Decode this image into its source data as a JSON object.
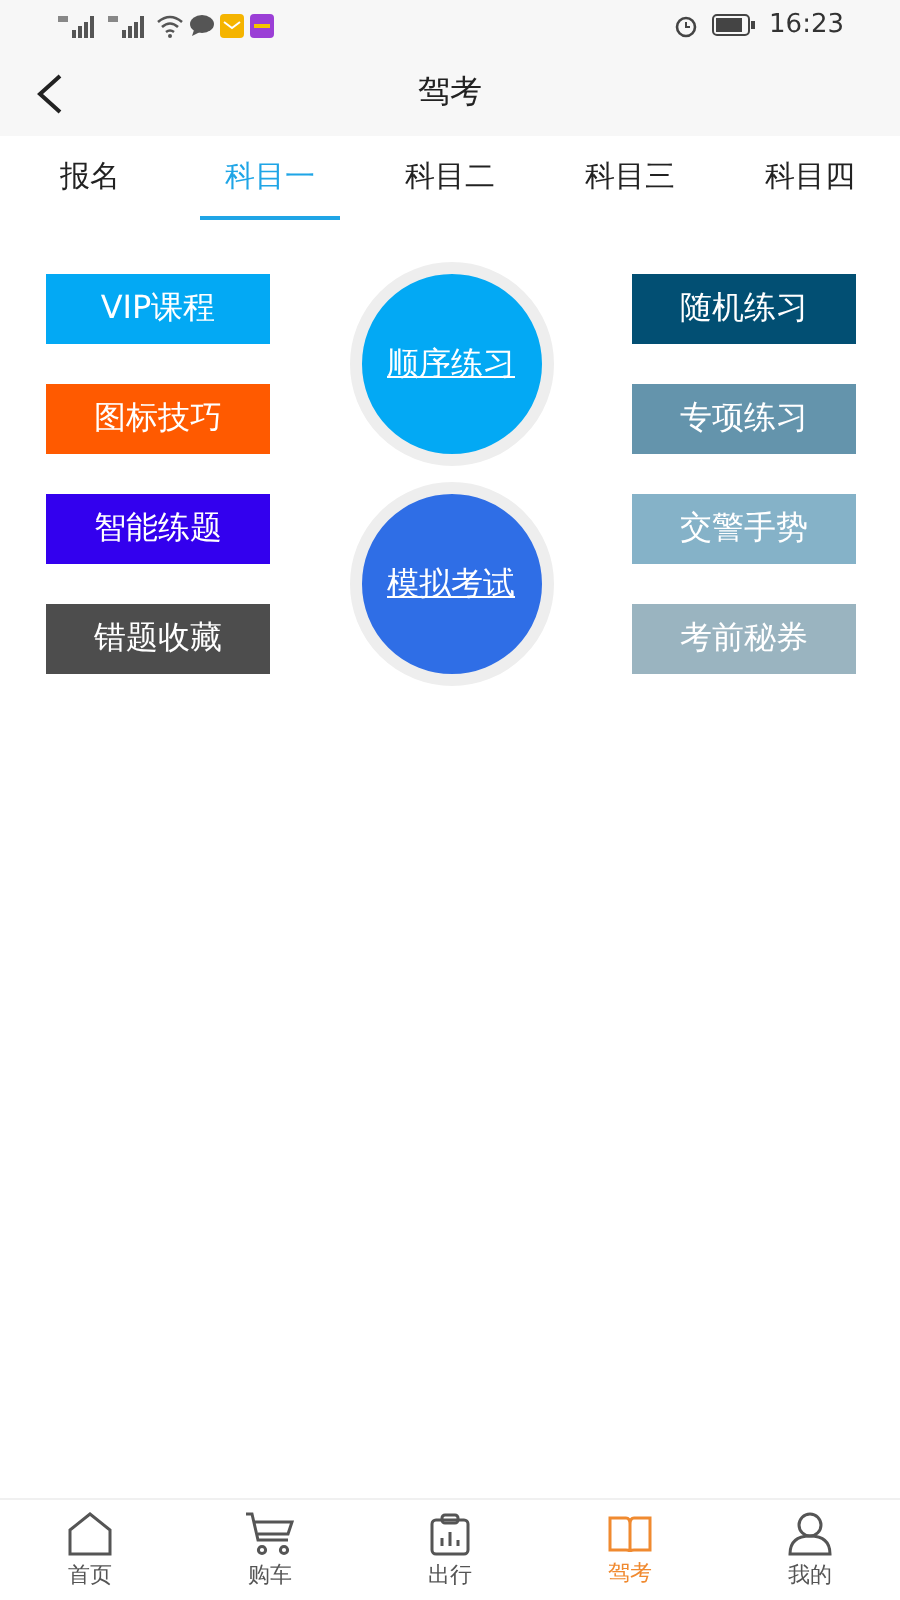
{
  "status_bar": {
    "time": "16:23"
  },
  "header": {
    "title": "驾考"
  },
  "tabs": [
    {
      "label": "报名",
      "selected": false
    },
    {
      "label": "科目一",
      "selected": true
    },
    {
      "label": "科目二",
      "selected": false
    },
    {
      "label": "科目三",
      "selected": false
    },
    {
      "label": "科目四",
      "selected": false
    }
  ],
  "left_buttons": [
    {
      "label": "VIP课程",
      "color": "#03a9f4"
    },
    {
      "label": "图标技巧",
      "color": "#ff5a00"
    },
    {
      "label": "智能练题",
      "color": "#3300ee"
    },
    {
      "label": "错题收藏",
      "color": "#4d4d4d"
    }
  ],
  "center_buttons": [
    {
      "label": "顺序练习",
      "color": "#03a9f4"
    },
    {
      "label": "模拟考试",
      "color": "#2f6ee6"
    }
  ],
  "right_buttons": [
    {
      "label": "随机练习",
      "color": "#024f73"
    },
    {
      "label": "专项练习",
      "color": "#6494ac"
    },
    {
      "label": "交警手势",
      "color": "#85b2c8"
    },
    {
      "label": "考前秘券",
      "color": "#9ab4c0"
    }
  ],
  "bottom_nav": [
    {
      "label": "首页",
      "selected": false
    },
    {
      "label": "购车",
      "selected": false
    },
    {
      "label": "出行",
      "selected": false
    },
    {
      "label": "驾考",
      "selected": true
    },
    {
      "label": "我的",
      "selected": false
    }
  ]
}
